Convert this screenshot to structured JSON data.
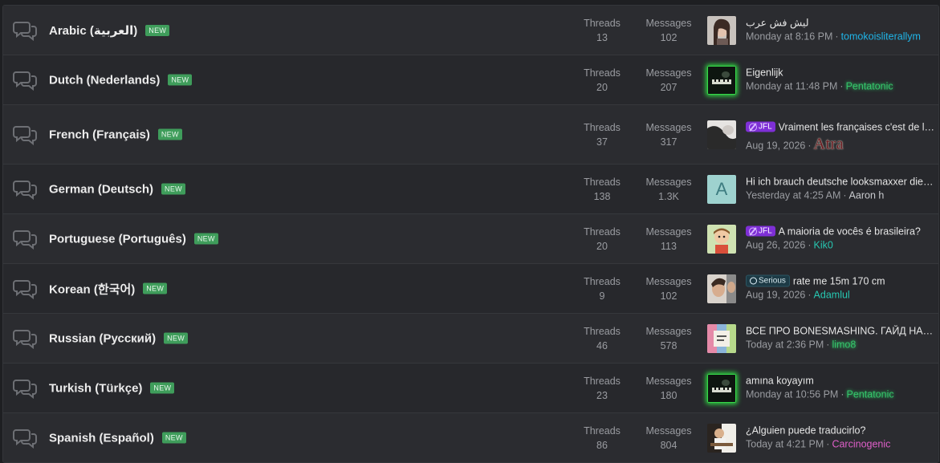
{
  "stat_labels": {
    "threads": "Threads",
    "messages": "Messages"
  },
  "new_badge": "NEW",
  "forums": [
    {
      "title": "Arabic (العربية)",
      "threads": "13",
      "messages": "102",
      "latest_title": "ليش فش عرب",
      "latest_time": "Monday at 8:16 PM",
      "latest_user": "tomokoisliterallym",
      "user_color": "#1fb5e8",
      "avatar": "girl-portrait"
    },
    {
      "title": "Dutch (Nederlands)",
      "threads": "20",
      "messages": "207",
      "latest_title": "Eigenlijk",
      "latest_time": "Monday at 11:48 PM",
      "latest_user": "Pentatonic",
      "user_color": "#35c46a",
      "avatar": "piano-glow"
    },
    {
      "title": "French (Français)",
      "threads": "37",
      "messages": "317",
      "prefix": "JFL",
      "latest_title": "Vraiment les françaises c'est de la merde",
      "latest_time": "Aug 19, 2026",
      "latest_user": "Atra",
      "user_color": "#6a1c22",
      "avatar": "bw-portrait"
    },
    {
      "title": "German (Deutsch)",
      "threads": "138",
      "messages": "1.3K",
      "latest_title": "Hi ich brauch deutsche looksmaxxer die mir helfen",
      "latest_time": "Yesterday at 4:25 AM",
      "latest_user": "Aaron h",
      "user_color": "#c9cbcf",
      "avatar": "letter",
      "avatar_letter": "A"
    },
    {
      "title": "Portuguese (Português)",
      "threads": "20",
      "messages": "113",
      "prefix": "JFL",
      "latest_title": "A maioria de vocês é brasileira?",
      "latest_time": "Aug 26, 2026",
      "latest_user": "Kik0",
      "user_color": "#27c7b1",
      "avatar": "cartoon"
    },
    {
      "title": "Korean (한국어)",
      "threads": "9",
      "messages": "102",
      "prefix": "Serious",
      "latest_title": "rate me 15m 170 cm",
      "latest_time": "Aug 19, 2026",
      "latest_user": "Adamlul",
      "user_color": "#27c7b1",
      "avatar": "man-portrait"
    },
    {
      "title": "Russian (Русский)",
      "threads": "46",
      "messages": "578",
      "latest_title": "ВСЕ ПРО BONESMASHING. ГАЙД НА РУССКОМ",
      "latest_time": "Today at 2:36 PM",
      "latest_user": "limo8",
      "user_color": "#35c46a",
      "avatar": "colorful"
    },
    {
      "title": "Turkish (Türkçe)",
      "threads": "23",
      "messages": "180",
      "latest_title": "amına koyayım",
      "latest_time": "Monday at 10:56 PM",
      "latest_user": "Pentatonic",
      "user_color": "#35c46a",
      "avatar": "piano-glow"
    },
    {
      "title": "Spanish (Español)",
      "threads": "86",
      "messages": "804",
      "latest_title": "¿Alguien puede traducirlo?",
      "latest_time": "Today at 4:21 PM",
      "latest_user": "Carcinogenic",
      "user_color": "#e05fc9",
      "avatar": "musician"
    }
  ]
}
